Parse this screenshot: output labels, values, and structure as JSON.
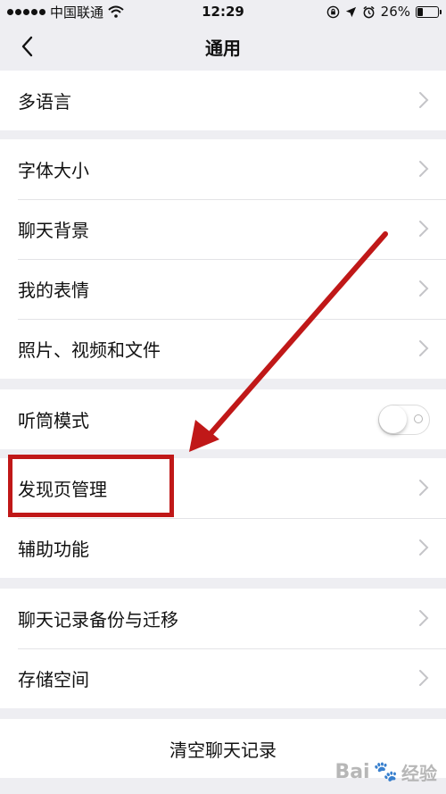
{
  "status_bar": {
    "carrier": "中国联通",
    "time": "12:29",
    "battery": "26%",
    "icons": [
      "signal-dots-icon",
      "wifi-icon",
      "orientation-lock-icon",
      "location-icon",
      "alarm-icon",
      "battery-icon"
    ]
  },
  "nav": {
    "title": "通用",
    "back_icon": "chevron-left-icon"
  },
  "groups": [
    {
      "items": [
        {
          "label": "多语言"
        }
      ]
    },
    {
      "items": [
        {
          "label": "字体大小"
        },
        {
          "label": "聊天背景"
        },
        {
          "label": "我的表情"
        },
        {
          "label": "照片、视频和文件"
        }
      ]
    },
    {
      "items": [
        {
          "label": "听筒模式",
          "toggle": true,
          "toggle_on": false
        }
      ]
    },
    {
      "items": [
        {
          "label": "发现页管理",
          "highlighted": true
        },
        {
          "label": "辅助功能"
        }
      ]
    },
    {
      "items": [
        {
          "label": "聊天记录备份与迁移"
        },
        {
          "label": "存储空间"
        }
      ]
    }
  ],
  "clear_button": "清空聊天记录",
  "annotation_color": "#c01818",
  "watermark": {
    "text": "经验",
    "brand": "Bai"
  }
}
